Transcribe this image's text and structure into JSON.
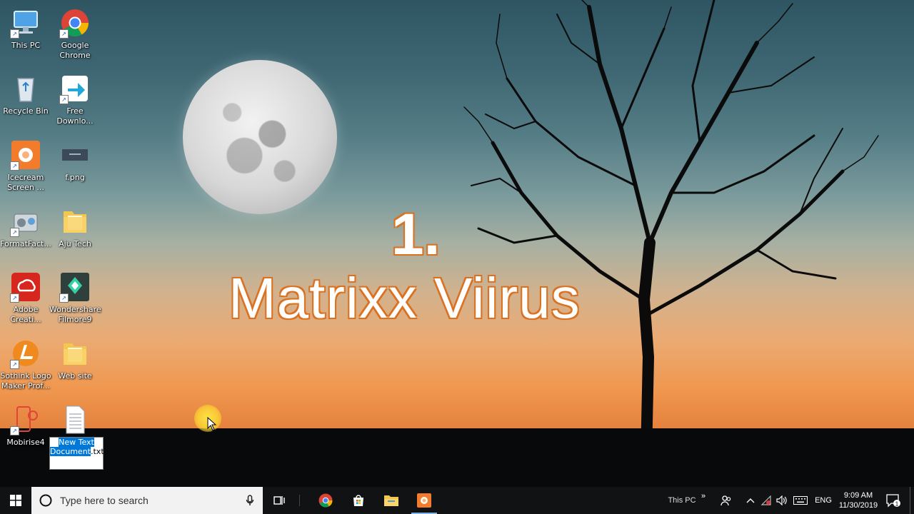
{
  "desktop": {
    "icons": [
      {
        "label": "This PC"
      },
      {
        "label": "Google Chrome"
      },
      {
        "label": "Recycle Bin"
      },
      {
        "label": "Free Downlo..."
      },
      {
        "label": "Icecream Screen ..."
      },
      {
        "label": "f.png"
      },
      {
        "label": "FormatFact..."
      },
      {
        "label": "Aju Tech"
      },
      {
        "label": "Adobe Creati..."
      },
      {
        "label": "Wondershare Filmore9"
      },
      {
        "label": "Sothink Logo Maker Prof..."
      },
      {
        "label": "Web site"
      },
      {
        "label": "Mobirise4"
      }
    ],
    "rename": {
      "selected_text": "New Text Document",
      "rest_text": ".txt"
    },
    "overlay": {
      "number": "1.",
      "title": "Matrixx Viirus",
      "outline_color": "#e07a2a"
    }
  },
  "taskbar": {
    "search_placeholder": "Type here to search",
    "pinned": [
      "Google Chrome",
      "Microsoft Store",
      "File Explorer",
      "Icecream Screen Recorder"
    ],
    "address_toolbar": "This PC",
    "chevron": "»",
    "language": "ENG",
    "time": "9:09 AM",
    "date": "11/30/2019",
    "notification_count": "1",
    "accent": "#0078d7"
  }
}
